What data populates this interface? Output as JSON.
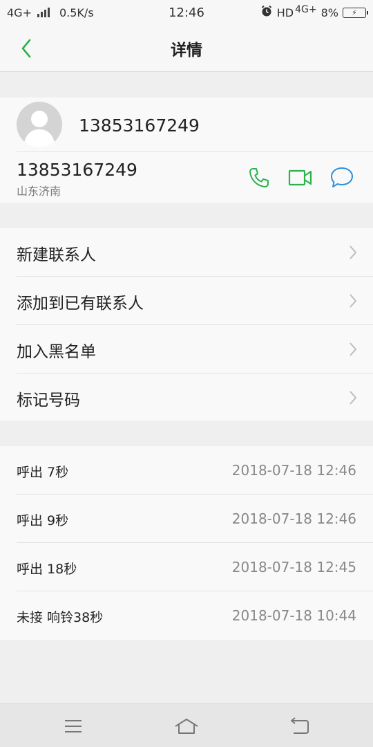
{
  "status_bar": {
    "network": "4G+",
    "speed": "0.5K/s",
    "time": "12:46",
    "hd_label": "HD",
    "network_right": "4G+",
    "battery_pct": "8%"
  },
  "header": {
    "title": "详情"
  },
  "contact": {
    "name": "13853167249",
    "number": "13853167249",
    "location": "山东济南"
  },
  "menu": {
    "items": [
      {
        "label": "新建联系人"
      },
      {
        "label": "添加到已有联系人"
      },
      {
        "label": "加入黑名单"
      },
      {
        "label": "标记号码"
      }
    ]
  },
  "call_log": [
    {
      "type": "呼出 7秒",
      "time": "2018-07-18 12:46"
    },
    {
      "type": "呼出 9秒",
      "time": "2018-07-18 12:46"
    },
    {
      "type": "呼出 18秒",
      "time": "2018-07-18 12:45"
    },
    {
      "type": "未接 响铃38秒",
      "time": "2018-07-18 10:44"
    }
  ],
  "colors": {
    "green_accent": "#2bb24c",
    "blue_accent": "#2b8fe0"
  }
}
